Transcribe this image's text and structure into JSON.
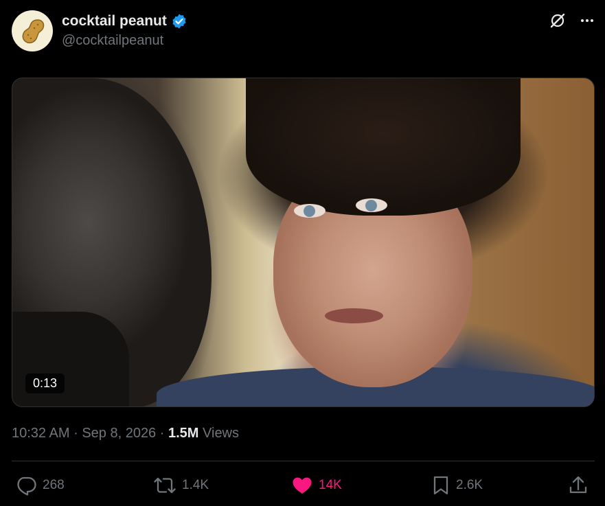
{
  "author": {
    "display_name": "cocktail peanut",
    "handle": "@cocktailpeanut",
    "verified": true
  },
  "media": {
    "duration": "0:13"
  },
  "meta": {
    "time": "10:32 AM",
    "separator": "·",
    "date": "Sep 8, 2026",
    "views_count": "1.5M",
    "views_label": "Views"
  },
  "actions": {
    "replies": "268",
    "reposts": "1.4K",
    "likes": "14K",
    "bookmarks": "2.6K"
  },
  "icons": {
    "verified": "verified-badge-icon",
    "grok": "grok-icon",
    "more": "more-icon",
    "reply": "reply-icon",
    "repost": "repost-icon",
    "like": "heart-icon",
    "bookmark": "bookmark-icon",
    "share": "share-icon"
  },
  "colors": {
    "background": "#000000",
    "text_primary": "#e7e9ea",
    "text_secondary": "#71767b",
    "verified": "#1d9bf0",
    "like_active": "#f91880",
    "divider": "#2f3336"
  }
}
